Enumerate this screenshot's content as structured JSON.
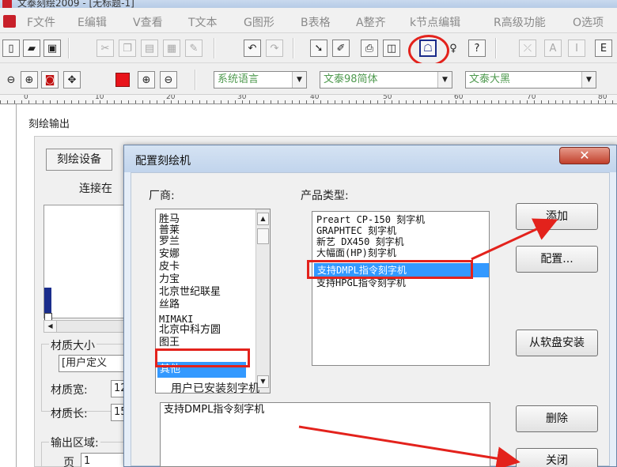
{
  "window": {
    "title": "文泰刻绘2009 - [无标题-1]"
  },
  "menu": [
    "F文件",
    "E编辑",
    "V查看",
    "T文本",
    "G图形",
    "B表格",
    "A整齐",
    "k节点编辑",
    "R高级功能",
    "O选项"
  ],
  "toolbar2": {
    "language_combo": "系统语言",
    "font_combo": "文泰98简体",
    "font_combo2": "文泰大黑"
  },
  "ruler": {
    "labels": [
      "0",
      "10",
      "20",
      "30",
      "40",
      "50",
      "60",
      "70",
      "80"
    ]
  },
  "output_window": {
    "title": "刻绘输出",
    "device_button": "刻绘设备",
    "connect_label": "连接在",
    "material_size_group": "材质大小",
    "material_size_value": "[用户定义",
    "material_width_label": "材质宽:",
    "material_width_value": "12",
    "material_length_label": "材质长:",
    "material_length_value": "15",
    "output_area_group": "输出区域:",
    "page_label": "页",
    "page_value": "1"
  },
  "dialog": {
    "title": "配置刻绘机",
    "close_glyph": "✕",
    "vendor_label": "厂商:",
    "vendors": [
      "胜马",
      "普莱",
      "罗兰",
      "安娜",
      "皮卡",
      "力宝",
      "北京世纪联星",
      "丝路",
      "MIMAKI",
      "北京中科方圆",
      "图王"
    ],
    "vendor_selected": "其他",
    "product_label": "产品类型:",
    "products": [
      "Preart CP-150 刻字机",
      "GRAPHTEC 刻字机",
      "新艺 DX450 刻字机",
      "大幅面(HP)刻字机"
    ],
    "product_selected": "支持DMPL指令刻字机",
    "product_after": "支持HPGL指令刻字机",
    "installed_label": "用户已安装刻字机",
    "installed": [
      "支持DMPL指令刻字机"
    ],
    "buttons": {
      "add": "添加",
      "configure": "配置...",
      "install_floppy": "从软盘安装",
      "delete": "删除",
      "close": "关闭"
    }
  },
  "colors": {
    "annotation_red": "#e3221c",
    "selection_blue": "#3399ff"
  }
}
